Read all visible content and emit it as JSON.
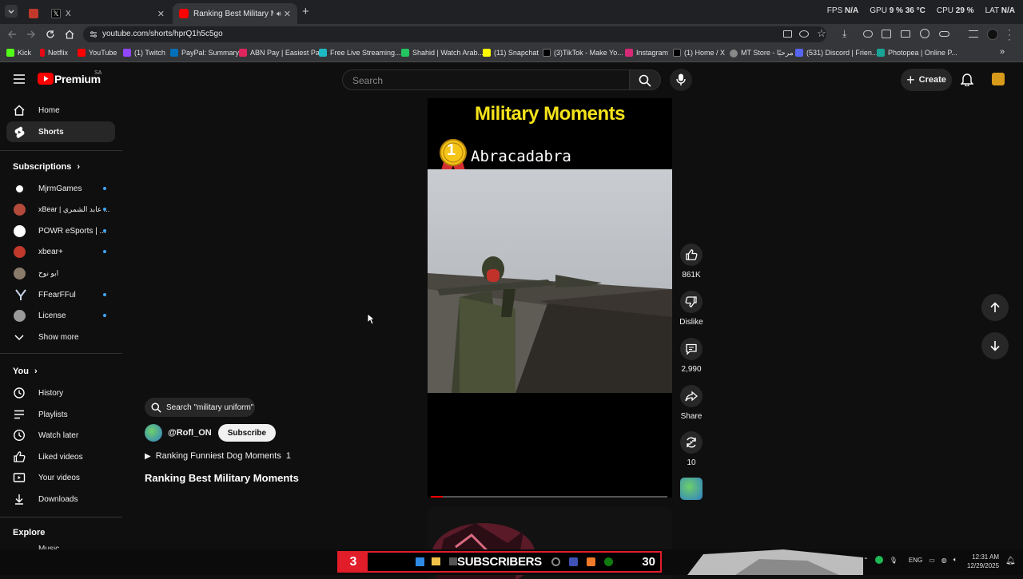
{
  "browser": {
    "tabs": [
      {
        "label": "X"
      },
      {
        "label": "Ranking Best Military Mome"
      }
    ],
    "stats": {
      "fps_label": "FPS",
      "fps_value": "N/A",
      "gpu_label": "GPU",
      "gpu_value": "9 %",
      "gpu_temp": "36 °C",
      "cpu_label": "CPU",
      "cpu_value": "29 %",
      "lat_label": "LAT",
      "lat_value": "N/A"
    },
    "url": "youtube.com/shorts/hprQ1h5c5go",
    "bookmarks": [
      {
        "label": "Kick",
        "color": "#53fc18"
      },
      {
        "label": "Netflix",
        "color": "#e50914"
      },
      {
        "label": "YouTube",
        "color": "#ff0000"
      },
      {
        "label": "(1) Twitch",
        "color": "#9146ff"
      },
      {
        "label": "PayPal: Summary",
        "color": "#0070ba"
      },
      {
        "label": "ABN Pay | Easiest Pa...",
        "color": "#e0245e"
      },
      {
        "label": "Free Live Streaming...",
        "color": "#1db9c3"
      },
      {
        "label": "Shahid | Watch Arab...",
        "color": "#22c55e"
      },
      {
        "label": "(11) Snapchat",
        "color": "#fffc00"
      },
      {
        "label": "(3)TikTok - Make Yo...",
        "color": "#000000"
      },
      {
        "label": "Instagram",
        "color": "#d62976"
      },
      {
        "label": "(1) Home / X",
        "color": "#000000"
      },
      {
        "label": "MT Store - مرحبًا",
        "color": "#888888"
      },
      {
        "label": "(531) Discord | Frien...",
        "color": "#5865f2"
      },
      {
        "label": "Photopea | Online P...",
        "color": "#18a497"
      }
    ]
  },
  "header": {
    "logo": "Premium",
    "logo_region": "SA",
    "search_placeholder": "Search",
    "create_label": "Create"
  },
  "sidebar": {
    "main": [
      {
        "label": "Home",
        "icon": "home-icon"
      },
      {
        "label": "Shorts",
        "icon": "shorts-icon"
      }
    ],
    "subscriptions_title": "Subscriptions",
    "subscriptions": [
      {
        "label": "MjrmGames",
        "color": "#ffffff"
      },
      {
        "label": "xBear | عابد الشمري ...",
        "color": "#b34a3a"
      },
      {
        "label": "POWR eSports | ...",
        "color": "#ffffff"
      },
      {
        "label": "xbear+",
        "color": "#c0392b"
      },
      {
        "label": "ابو نوح",
        "color": "#8a7a6a"
      },
      {
        "label": "FFearFFul",
        "color": "#c9d6e8"
      },
      {
        "label": "License",
        "color": "#9a9a9a"
      }
    ],
    "show_more": "Show more",
    "you_title": "You",
    "you_items": [
      {
        "label": "History"
      },
      {
        "label": "Playlists"
      },
      {
        "label": "Watch later"
      },
      {
        "label": "Liked videos"
      },
      {
        "label": "Your videos"
      },
      {
        "label": "Downloads"
      }
    ],
    "explore_title": "Explore",
    "explore_partial": "Music"
  },
  "short": {
    "overlay_title": "Military Moments",
    "rank_number": "1",
    "overlay_subtitle": "Abracadabra",
    "progress": 0.05,
    "search_chip": "Search \"military uniform\"",
    "channel": "@Rofl_ON",
    "subscribe_label": "Subscribe",
    "playlist": "Ranking Funniest Dog Moments",
    "playlist_count": "1",
    "title": "Ranking Best Military Moments"
  },
  "actions": {
    "likes": "861K",
    "dislike": "Dislike",
    "comments": "2,990",
    "share": "Share",
    "remix": "10"
  },
  "taskbar": {
    "sub_count": "3",
    "sub_label": "SUBSCRIBERS",
    "sub_goal": "30",
    "lang": "ENG",
    "time": "12:31 AM",
    "date": "12/29/2025"
  }
}
